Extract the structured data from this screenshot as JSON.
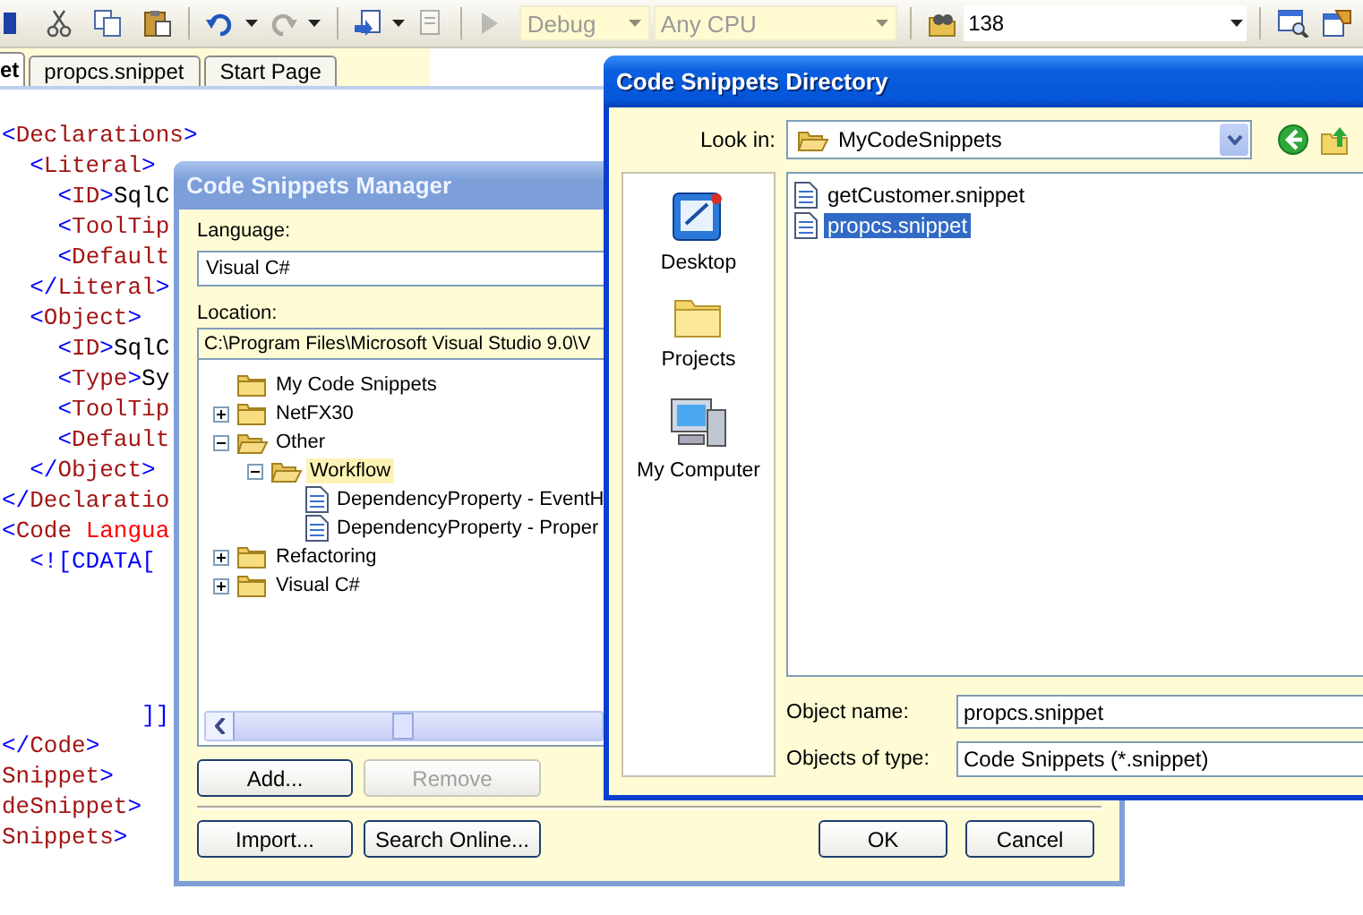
{
  "toolbar": {
    "buttons": [
      {
        "disabled": false
      },
      {
        "disabled": false
      },
      {
        "disabled": false
      },
      {
        "disabled": false
      },
      {
        "disabled": false
      },
      {
        "disabled": true
      },
      {
        "disabled": false
      },
      {
        "disabled": true
      },
      {
        "disabled": true
      },
      {
        "disabled": false
      },
      {
        "disabled": false
      },
      {
        "disabled": false
      }
    ],
    "configuration": {
      "value": "Debug",
      "disabled": true
    },
    "platform": {
      "value": "Any CPU",
      "disabled": true
    },
    "find": {
      "value": "138"
    }
  },
  "tabs": [
    {
      "label": "et",
      "selected": true
    },
    {
      "label": "propcs.snippet",
      "selected": false
    },
    {
      "label": "Start Page",
      "selected": false
    }
  ],
  "editor": {
    "lines_top": [
      [
        {
          "kind": "punct",
          "text": "<"
        },
        {
          "kind": "tag",
          "text": "Declarations"
        },
        {
          "kind": "punct",
          "text": ">"
        }
      ],
      [
        {
          "kind": "punct",
          "text": "  <"
        },
        {
          "kind": "tag",
          "text": "Literal"
        },
        {
          "kind": "punct",
          "text": ">"
        }
      ],
      [
        {
          "kind": "punct",
          "text": "    <"
        },
        {
          "kind": "tag",
          "text": "ID"
        },
        {
          "kind": "punct",
          "text": ">"
        },
        {
          "kind": "text",
          "text": "SqlC"
        }
      ],
      [
        {
          "kind": "punct",
          "text": "    <"
        },
        {
          "kind": "tag",
          "text": "ToolTip"
        }
      ],
      [
        {
          "kind": "punct",
          "text": "    <"
        },
        {
          "kind": "tag",
          "text": "Default"
        }
      ],
      [
        {
          "kind": "punct",
          "text": "  </"
        },
        {
          "kind": "tag",
          "text": "Literal"
        },
        {
          "kind": "punct",
          "text": ">"
        }
      ],
      [
        {
          "kind": "punct",
          "text": "  <"
        },
        {
          "kind": "tag",
          "text": "Object"
        },
        {
          "kind": "punct",
          "text": ">"
        }
      ],
      [
        {
          "kind": "punct",
          "text": "    <"
        },
        {
          "kind": "tag",
          "text": "ID"
        },
        {
          "kind": "punct",
          "text": ">"
        },
        {
          "kind": "text",
          "text": "SqlC"
        }
      ],
      [
        {
          "kind": "punct",
          "text": "    <"
        },
        {
          "kind": "tag",
          "text": "Type"
        },
        {
          "kind": "punct",
          "text": ">"
        },
        {
          "kind": "text",
          "text": "Sy"
        }
      ],
      [
        {
          "kind": "punct",
          "text": "    <"
        },
        {
          "kind": "tag",
          "text": "ToolTip"
        }
      ],
      [
        {
          "kind": "punct",
          "text": "    <"
        },
        {
          "kind": "tag",
          "text": "Default"
        }
      ],
      [
        {
          "kind": "punct",
          "text": "  </"
        },
        {
          "kind": "tag",
          "text": "Object"
        },
        {
          "kind": "punct",
          "text": ">"
        }
      ],
      [
        {
          "kind": "punct",
          "text": "</"
        },
        {
          "kind": "tag",
          "text": "Declaratio"
        }
      ],
      [
        {
          "kind": "punct",
          "text": "<"
        },
        {
          "kind": "tag",
          "text": "Code"
        },
        {
          "kind": "attr",
          "text": " Langua"
        }
      ],
      [
        {
          "kind": "punct",
          "text": "  <![CDATA["
        }
      ]
    ],
    "lines_bottom": [
      [
        {
          "kind": "punct",
          "text": "          ]]"
        }
      ],
      [
        {
          "kind": "punct",
          "text": "</"
        },
        {
          "kind": "tag",
          "text": "Code"
        },
        {
          "kind": "punct",
          "text": ">"
        }
      ],
      [
        {
          "kind": "tag",
          "text": "Snippet"
        },
        {
          "kind": "punct",
          "text": ">"
        }
      ],
      [
        {
          "kind": "tag",
          "text": "deSnippet"
        },
        {
          "kind": "punct",
          "text": ">"
        }
      ],
      [
        {
          "kind": "tag",
          "text": "Snippets"
        },
        {
          "kind": "punct",
          "text": ">"
        }
      ]
    ]
  },
  "manager": {
    "title": "Code Snippets Manager",
    "language_label": "Language:",
    "language": "Visual C#",
    "location_label": "Location:",
    "location": "C:\\Program Files\\Microsoft Visual Studio 9.0\\V",
    "tree": [
      {
        "label": "My Code Snippets",
        "kind": "folder",
        "selected": false
      },
      {
        "label": "NetFX30",
        "kind": "folder",
        "expanded": false,
        "selected": false
      },
      {
        "label": "Other",
        "kind": "folder",
        "expanded": true,
        "selected": false,
        "children": [
          {
            "label": "Workflow",
            "kind": "folder",
            "expanded": true,
            "selected": true,
            "children": [
              {
                "label": "DependencyProperty - EventH",
                "kind": "file",
                "selected": false
              },
              {
                "label": "DependencyProperty - Proper",
                "kind": "file",
                "selected": false
              }
            ]
          }
        ]
      },
      {
        "label": "Refactoring",
        "kind": "folder",
        "expanded": false,
        "selected": false
      },
      {
        "label": "Visual C#",
        "kind": "folder",
        "expanded": false,
        "selected": false
      }
    ],
    "buttons": [
      {
        "label": "Add...",
        "disabled": false
      },
      {
        "label": "Remove",
        "disabled": true
      }
    ],
    "footer_buttons": [
      {
        "label": "Import...",
        "disabled": false
      },
      {
        "label": "Search Online...",
        "disabled": false
      }
    ],
    "dialog_buttons": [
      {
        "label": "OK",
        "disabled": false
      },
      {
        "label": "Cancel",
        "disabled": false
      }
    ]
  },
  "directory": {
    "title": "Code Snippets Directory",
    "look_in_label": "Look in:",
    "look_in": "MyCodeSnippets",
    "places": [
      {
        "label": "Desktop",
        "selected": false
      },
      {
        "label": "Projects",
        "selected": false
      },
      {
        "label": "My Computer",
        "selected": false
      }
    ],
    "files": [
      {
        "name": "getCustomer.snippet",
        "selected": false
      },
      {
        "name": "propcs.snippet",
        "selected": true
      }
    ],
    "object_name_label": "Object name:",
    "object_name": "propcs.snippet",
    "type_label": "Objects of type:",
    "type": "Code Snippets (*.snippet)"
  }
}
